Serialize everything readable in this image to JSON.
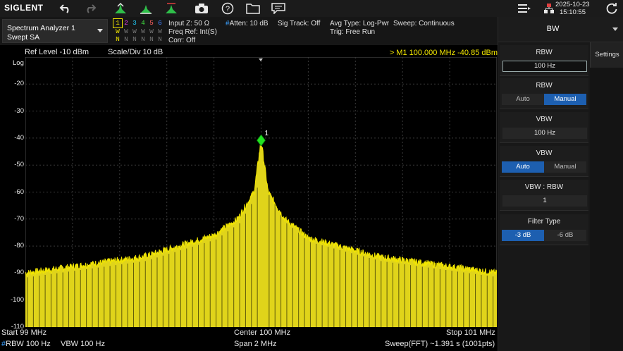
{
  "topbar": {
    "brand": "SIGLENT",
    "date": "2025-10-23",
    "time": "15:10:55"
  },
  "mode": {
    "line1": "Spectrum Analyzer 1",
    "line2": "Swept SA"
  },
  "traces": {
    "numbers": [
      "1",
      "2",
      "3",
      "4",
      "5",
      "6"
    ],
    "types": [
      "W",
      "W",
      "W",
      "W",
      "W",
      "W"
    ],
    "detectors": [
      "N",
      "N",
      "N",
      "N",
      "N",
      "N"
    ],
    "colors": [
      "#f2e600",
      "#e040e0",
      "#20d0ff",
      "#40e040",
      "#ff6060",
      "#4080ff"
    ]
  },
  "info": {
    "input_z": "Input Z: 50 Ω",
    "freq_ref": "Freq Ref: Int(S)",
    "corr": "Corr: Off",
    "atten_hash": "#",
    "atten": "Atten: 10 dB",
    "sig_track": "Sig Track: Off",
    "avg_type": "Avg Type: Log-Pwr",
    "trig": "Trig: Free Run",
    "sweep": "Sweep: Continuous"
  },
  "plot": {
    "ref_level": "Ref Level  -10 dBm",
    "scale_div": "Scale/Div  10 dB",
    "marker_readout": ">  M1   100.000 MHz   -40.85 dBm",
    "log_label": "Log",
    "y_ticks": [
      "-20",
      "-30",
      "-40",
      "-50",
      "-60",
      "-70",
      "-80",
      "-90",
      "-100",
      "-110"
    ],
    "marker_label": "1"
  },
  "chart_data": {
    "type": "line",
    "x_unit": "MHz",
    "y_unit": "dBm",
    "x_start": 99,
    "x_stop": 101,
    "center": 100,
    "ylim": [
      -110,
      -10
    ],
    "points": 1001,
    "trace_color": "#f2e600",
    "peak": {
      "x": 100.0,
      "y": -40.85
    },
    "envelope": [
      {
        "x": 99.0,
        "y": -90
      },
      {
        "x": 99.5,
        "y": -84
      },
      {
        "x": 99.8,
        "y": -76
      },
      {
        "x": 99.9,
        "y": -70
      },
      {
        "x": 99.97,
        "y": -60
      },
      {
        "x": 100.0,
        "y": -40.85
      },
      {
        "x": 100.03,
        "y": -60
      },
      {
        "x": 100.1,
        "y": -70
      },
      {
        "x": 100.2,
        "y": -77
      },
      {
        "x": 100.5,
        "y": -84
      },
      {
        "x": 101.0,
        "y": -90
      }
    ],
    "noise_floor": -110,
    "grid": true
  },
  "footer": {
    "start": "Start  99 MHz",
    "center": "Center  100 MHz",
    "stop": "Stop  101 MHz",
    "rbw_hash": "#",
    "rbw": "RBW  100 Hz",
    "vbw": "VBW  100 Hz",
    "span": "Span  2 MHz",
    "sweep_time": "Sweep(FFT)  ~1.391 s (1001pts)"
  },
  "panel": {
    "title": "BW",
    "settings_tab": "Settings",
    "rbw_label": "RBW",
    "rbw_value": "100 Hz",
    "rbw_mode_label": "RBW",
    "rbw_auto": "Auto",
    "rbw_manual": "Manual",
    "vbw_label": "VBW",
    "vbw_value": "100 Hz",
    "vbw_mode_label": "VBW",
    "vbw_auto": "Auto",
    "vbw_manual": "Manual",
    "ratio_label": "VBW : RBW",
    "ratio_value": "1",
    "filter_label": "Filter Type",
    "filter_3db": "-3 dB",
    "filter_6db": "-6 dB"
  },
  "colors": {
    "accent": "#1d5fb0",
    "trace": "#f2e600",
    "marker": "#20e020"
  }
}
